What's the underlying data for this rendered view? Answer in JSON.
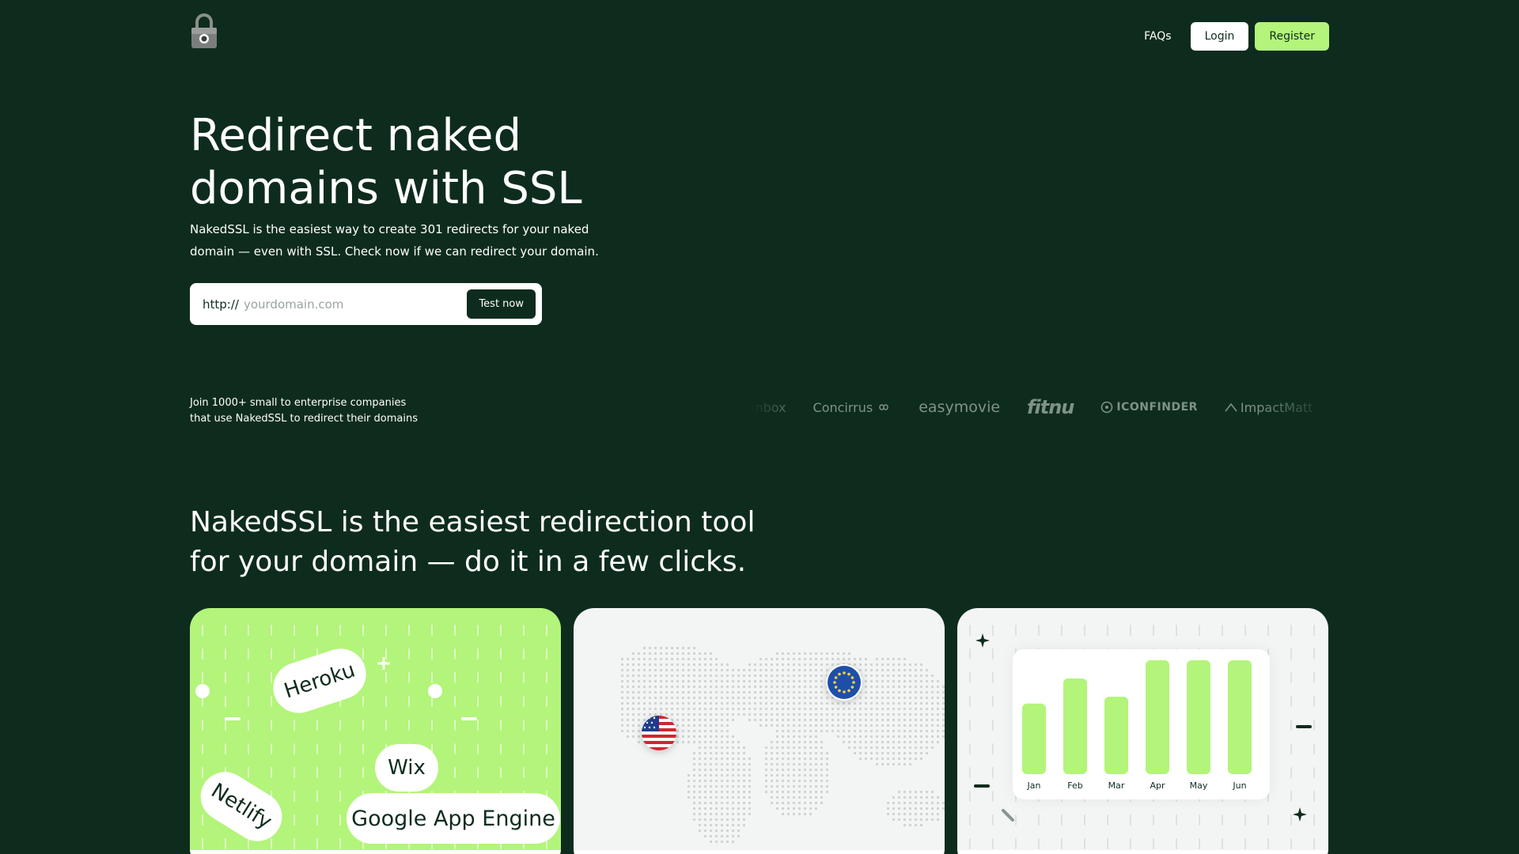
{
  "header": {
    "faq_label": "FAQs",
    "login_label": "Login",
    "register_label": "Register",
    "logo_icon": "padlock-icon"
  },
  "hero": {
    "title_line1": "Redirect naked",
    "title_line2": "domains with SSL",
    "subtitle": "NakedSSL is the easiest way to create 301 redirects for your naked domain — even with SSL. Check now if we can redirect your domain.",
    "prefix": "http://",
    "placeholder": "yourdomain.com",
    "value": "",
    "test_button": "Test now"
  },
  "trust": {
    "line1": "Join 1000+ small to enterprise companies",
    "line2": "that use NakedSSL to redirect their domains",
    "brands": [
      "inbox",
      "Concirrus",
      "easymovie",
      "fitnu",
      "ICONFINDER",
      "ImpactMatt"
    ]
  },
  "section": {
    "title_line1": "NakedSSL is the easiest redirection tool",
    "title_line2": "for your domain — do it in a few clicks."
  },
  "cards": {
    "platforms": [
      "Heroku",
      "Wix",
      "Netlify",
      "Google App Engine"
    ],
    "regions": [
      "us-flag-icon",
      "eu-flag-icon"
    ]
  },
  "colors": {
    "background": "#0e2c1d",
    "accent": "#b3f47a",
    "white": "#ffffff"
  },
  "chart_data": {
    "type": "bar",
    "categories": [
      "Jan",
      "Feb",
      "Mar",
      "Apr",
      "May",
      "Jun"
    ],
    "values": [
      62,
      84,
      68,
      100,
      100,
      100
    ],
    "ylim": [
      0,
      100
    ],
    "title": "",
    "xlabel": "",
    "ylabel": ""
  }
}
